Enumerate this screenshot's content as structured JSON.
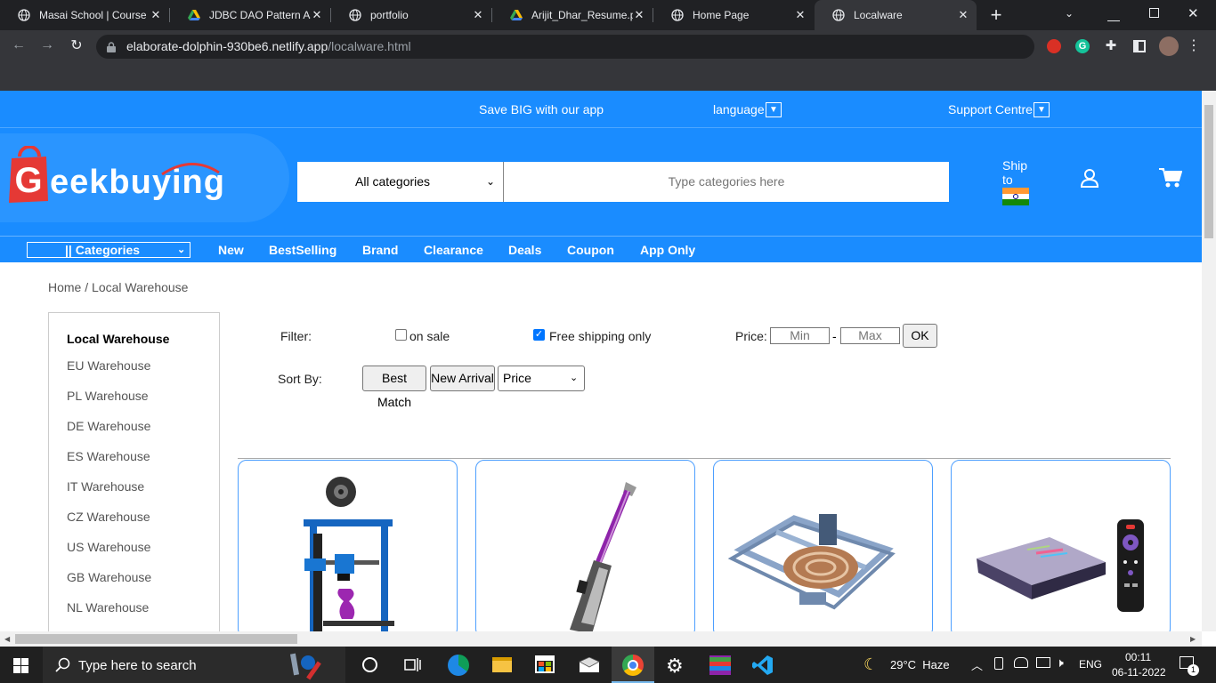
{
  "browser": {
    "tabs": [
      {
        "title": "Masai School | Course",
        "icon": "globe-icon"
      },
      {
        "title": "JDBC DAO Pattern Ass",
        "icon": "drive-icon"
      },
      {
        "title": "portfolio",
        "icon": "globe-icon"
      },
      {
        "title": "Arijit_Dhar_Resume.pc",
        "icon": "drive-icon"
      },
      {
        "title": "Home Page",
        "icon": "globe-icon"
      },
      {
        "title": "Localware",
        "icon": "globe-icon"
      }
    ],
    "close_glyph": "✕",
    "new_tab": "+",
    "url_host": "elaborate-dolphin-930be6.netlify.app",
    "url_path": "/localware.html"
  },
  "topbar": {
    "promo": "Save BIG with our app",
    "language": "language",
    "support": "Support Centre"
  },
  "header": {
    "logo_text": "Geekbuying",
    "category_select": "All categories",
    "search_placeholder": "Type categories here",
    "ship_to": "Ship to"
  },
  "nav": {
    "categories": "|| Categories",
    "links": [
      "New",
      "BestSelling",
      "Brand",
      "Clearance",
      "Deals",
      "Coupon",
      "App Only"
    ]
  },
  "breadcrumb": {
    "home": "Home",
    "sep": " / ",
    "current": "Local Warehouse"
  },
  "sidebar": {
    "title": "Local Warehouse",
    "items": [
      "EU Warehouse",
      "PL Warehouse",
      "DE Warehouse",
      "ES Warehouse",
      "IT Warehouse",
      "CZ Warehouse",
      "US Warehouse",
      "GB Warehouse",
      "NL Warehouse"
    ]
  },
  "filters": {
    "filter_label": "Filter:",
    "on_sale": "on sale",
    "on_sale_checked": false,
    "free_shipping": "Free shipping only",
    "free_shipping_checked": true,
    "price_label": "Price:",
    "min_placeholder": "Min",
    "dash": "-",
    "max_placeholder": "Max",
    "ok": "OK",
    "sort_label": "Sort By:",
    "best_match": "Best Match",
    "new_arrival": "New Arrival",
    "price_select": "Price"
  },
  "products": [
    {
      "icon": "3d-printer-icon"
    },
    {
      "icon": "floor-cleaner-icon"
    },
    {
      "icon": "laser-engraver-icon"
    },
    {
      "icon": "tv-box-icon"
    }
  ],
  "taskbar": {
    "search_placeholder": "Type here to search",
    "weather": "29°C  Haze",
    "lang": "ENG",
    "time": "00:11",
    "date": "06-11-2022",
    "notif_count": "1"
  },
  "colors": {
    "brand_blue": "#1a8cff",
    "card_border": "#4d9fff"
  }
}
